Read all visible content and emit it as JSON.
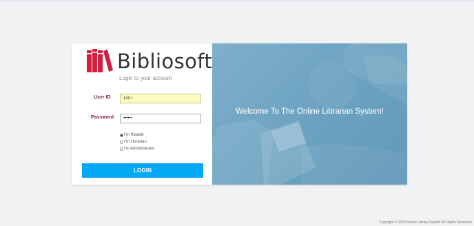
{
  "brand": {
    "name": "Bibliosoft",
    "tagline": "Login to your account",
    "logo_icon": "books-icon",
    "logo_color": "#d11f3f"
  },
  "form": {
    "user_label": "User ID",
    "user_value": "1007",
    "password_label": "Password",
    "password_value": "••••••",
    "roles": [
      {
        "label": "I'm Reader",
        "selected": true
      },
      {
        "label": "I'm Librarian",
        "selected": false
      },
      {
        "label": "I'm Administrator",
        "selected": false
      }
    ],
    "login_button": "LOGIN",
    "accent_color": "#03a9f4"
  },
  "hero": {
    "welcome_text": "Welcome To The Online Librarian System!",
    "color": "#6ea4c2"
  },
  "footer": {
    "copyright": "Copyright © 2018.Online Library System All Rights Reserved."
  }
}
